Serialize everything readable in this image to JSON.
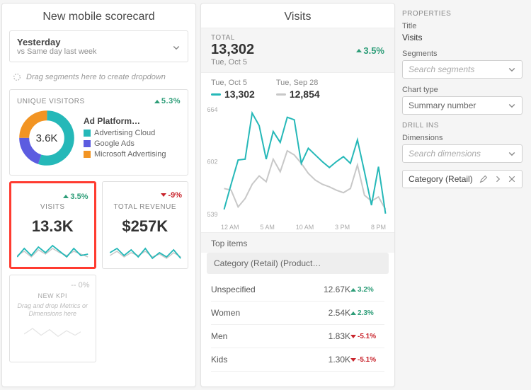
{
  "scorecard": {
    "title": "New mobile scorecard",
    "date_range": {
      "main": "Yesterday",
      "sub": "vs Same day last week"
    },
    "segment_drop": "Drag segments here to create dropdown",
    "unique_visitors": {
      "label": "UNIQUE VISITORS",
      "delta": "5.3%",
      "value": "3.6K",
      "legend_title": "Ad Platform…",
      "legend": [
        {
          "label": "Advertising Cloud",
          "color": "#25b8b8"
        },
        {
          "label": "Google Ads",
          "color": "#5c5ce0"
        },
        {
          "label": "Microsoft Advertising",
          "color": "#f29423"
        }
      ]
    },
    "tiles": {
      "visits": {
        "label": "VISITS",
        "value": "13.3K",
        "delta": "3.5%",
        "direction": "up"
      },
      "revenue": {
        "label": "TOTAL REVENUE",
        "value": "$257K",
        "delta": "-9%",
        "direction": "down"
      },
      "new": {
        "label": "NEW KPI",
        "sub": "Drag and drop Metrics or Dimensions here",
        "pct": "-- 0%"
      }
    }
  },
  "detail": {
    "title": "Visits",
    "total": {
      "label": "TOTAL",
      "value": "13,302",
      "sub": "Tue, Oct 5",
      "delta": "3.5%"
    },
    "compare": {
      "a": {
        "date": "Tue, Oct 5",
        "value": "13,302",
        "color": "#25b8b8"
      },
      "b": {
        "date": "Tue, Sep 28",
        "value": "12,854",
        "color": "#c8c8c8"
      }
    },
    "chart_data": {
      "type": "line",
      "x_labels": [
        "12 AM",
        "5 AM",
        "10 AM",
        "3 PM",
        "8 PM"
      ],
      "y_ticks": [
        539,
        602,
        664
      ],
      "ylim": [
        539,
        664
      ],
      "series": [
        {
          "name": "Tue, Oct 5",
          "color": "#25b8b8",
          "values": [
            545,
            575,
            604,
            605,
            660,
            645,
            605,
            638,
            625,
            655,
            652,
            600,
            618,
            610,
            602,
            595,
            602,
            608,
            600,
            628,
            590,
            550,
            596,
            540
          ]
        },
        {
          "name": "Tue, Sep 28",
          "color": "#c8c8c8",
          "values": [
            570,
            568,
            548,
            558,
            575,
            585,
            578,
            605,
            590,
            615,
            610,
            600,
            588,
            580,
            575,
            572,
            568,
            565,
            570,
            598,
            562,
            555,
            560,
            545
          ]
        }
      ]
    },
    "top_items": {
      "heading": "Top items",
      "category_header": "Category (Retail) (Product…",
      "rows": [
        {
          "name": "Unspecified",
          "value": "12.67K",
          "delta": "3.2%",
          "direction": "up"
        },
        {
          "name": "Women",
          "value": "2.54K",
          "delta": "2.3%",
          "direction": "up"
        },
        {
          "name": "Men",
          "value": "1.83K",
          "delta": "-5.1%",
          "direction": "down"
        },
        {
          "name": "Kids",
          "value": "1.30K",
          "delta": "-5.1%",
          "direction": "down"
        }
      ]
    }
  },
  "properties": {
    "header": "PROPERTIES",
    "title_label": "Title",
    "title_value": "Visits",
    "segments_label": "Segments",
    "segments_placeholder": "Search segments",
    "chart_type_label": "Chart type",
    "chart_type_value": "Summary number",
    "drillins_header": "DRILL INS",
    "dimensions_label": "Dimensions",
    "dimensions_placeholder": "Search dimensions",
    "drill_chip": "Category (Retail)"
  }
}
